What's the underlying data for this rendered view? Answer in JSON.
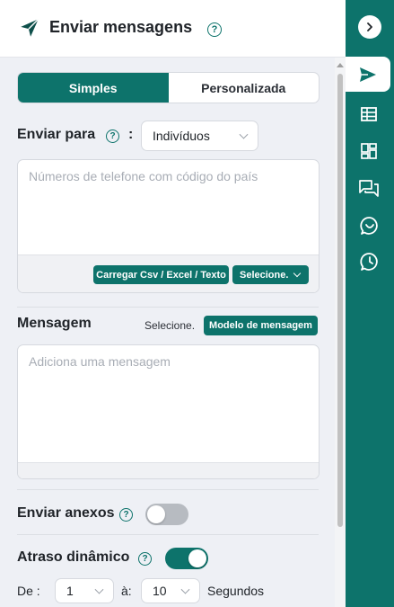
{
  "header": {
    "title": "Enviar mensagens",
    "help": "?"
  },
  "tabs": [
    {
      "label": "Simples",
      "active": true
    },
    {
      "label": "Personalizada",
      "active": false
    }
  ],
  "send_to": {
    "label": "Enviar para",
    "help": "?",
    "colon": ":",
    "selected": "Indivíduos",
    "placeholder": "Números de telefone com código do país",
    "upload_label": "Carregar Csv / Excel / Texto",
    "select_label": "Selecione."
  },
  "message": {
    "label": "Mensagem",
    "select_hint": "Selecione.",
    "template_label": "Modelo de mensagem",
    "placeholder": "Adiciona uma mensagem"
  },
  "attachments": {
    "label": "Enviar anexos",
    "help": "?",
    "enabled": false
  },
  "delay": {
    "label": "Atraso dinâmico",
    "help": "?",
    "enabled": true,
    "from_label": "De :",
    "from_value": "1",
    "to_label": "à:",
    "to_value": "10",
    "unit": "Segundos"
  },
  "rail": {
    "items": [
      "collapse-icon",
      "send-icon",
      "table-icon",
      "dashboard-icon",
      "chat-icon",
      "whatsapp-icon",
      "history-icon"
    ],
    "active": "send-icon"
  },
  "colors": {
    "accent": "#0d736b",
    "background": "#eef0f5"
  }
}
